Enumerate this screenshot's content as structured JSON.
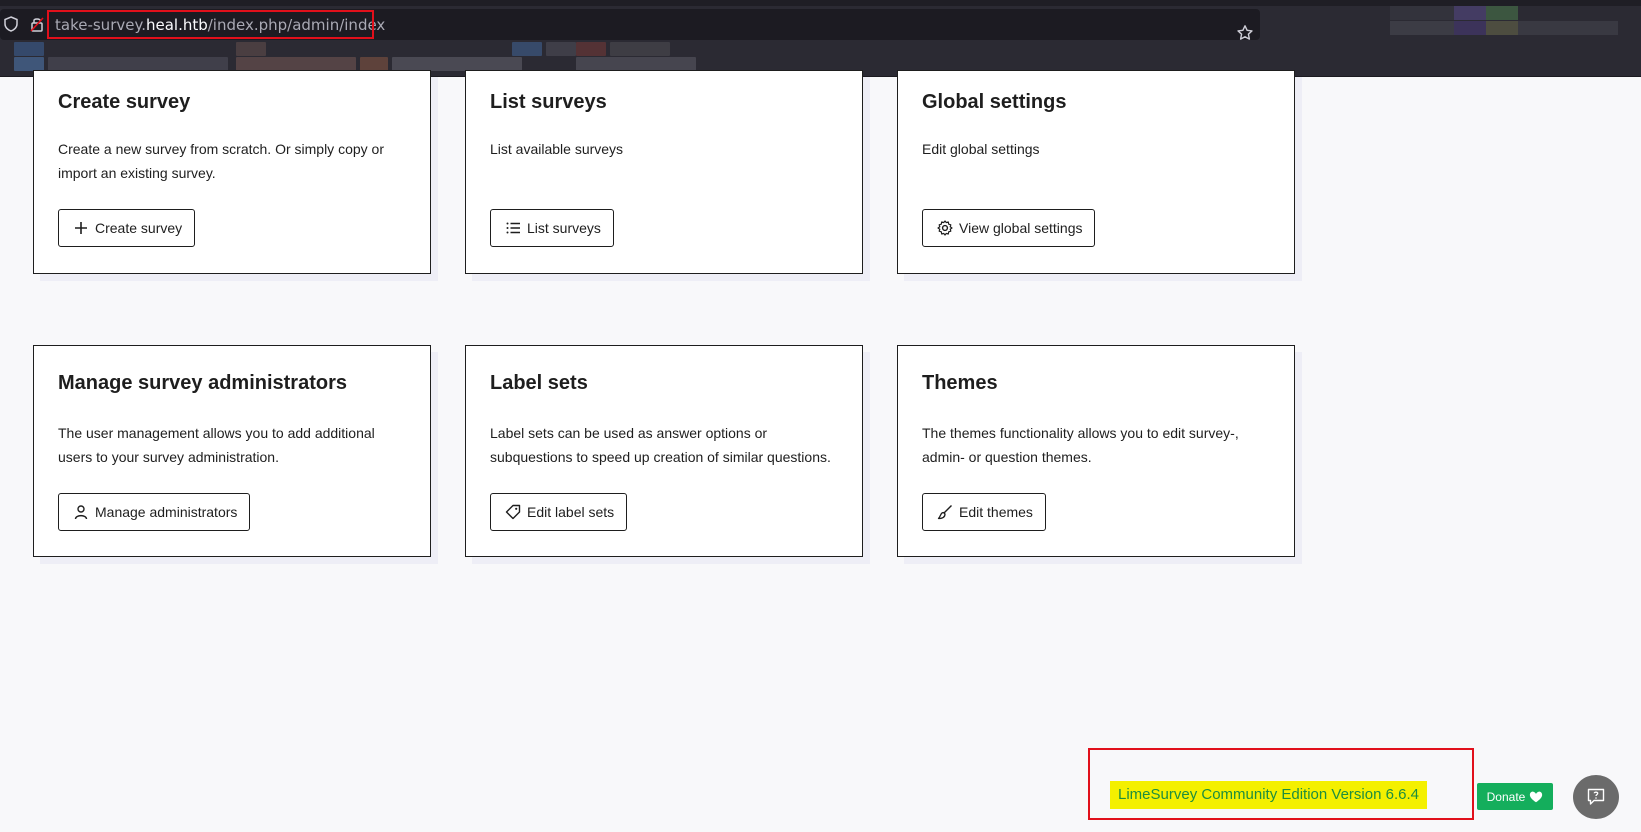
{
  "browser": {
    "url_host_prefix": "take-survey.",
    "url_host": "heal.htb",
    "url_path": "/index.php/admin/index"
  },
  "cards": [
    {
      "title": "Create survey",
      "description": "Create a new survey from scratch. Or simply copy or import an existing survey.",
      "button": "Create survey",
      "icon": "plus-icon"
    },
    {
      "title": "List surveys",
      "description": "List available surveys",
      "button": "List surveys",
      "icon": "list-icon"
    },
    {
      "title": "Global settings",
      "description": "Edit global settings",
      "button": "View global settings",
      "icon": "gear-icon"
    },
    {
      "title": "Manage survey administrators",
      "description": "The user management allows you to add additional users to your survey administration.",
      "button": "Manage administrators",
      "icon": "user-icon"
    },
    {
      "title": "Label sets",
      "description": "Label sets can be used as answer options or subquestions to speed up creation of similar questions.",
      "button": "Edit label sets",
      "icon": "tag-icon"
    },
    {
      "title": "Themes",
      "description": "The themes functionality allows you to edit survey-, admin- or question themes.",
      "button": "Edit themes",
      "icon": "brush-icon"
    }
  ],
  "footer": {
    "version": "LimeSurvey Community Edition Version 6.6.4",
    "donate": "Donate"
  },
  "colors": {
    "highlight_red": "#e1101b",
    "version_bg": "#f4f000",
    "donate_green": "#14ae5c"
  }
}
